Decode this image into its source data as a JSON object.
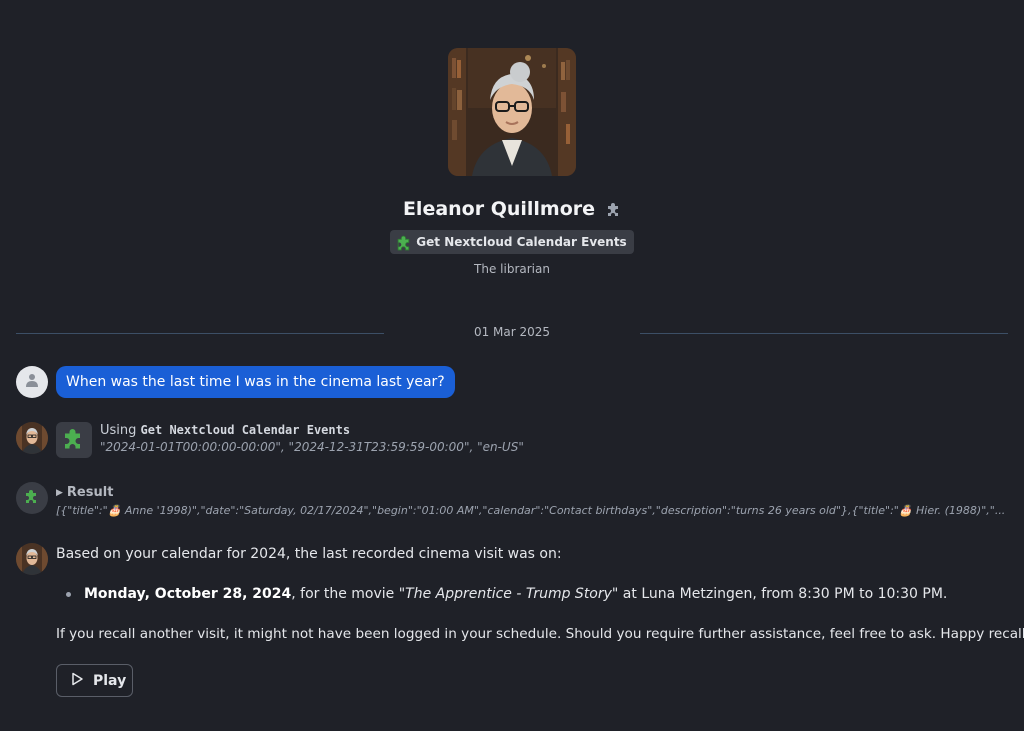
{
  "profile": {
    "name": "Eleanor Quillmore",
    "tool_badge": "Get Nextcloud Calendar Events",
    "subtitle": "The librarian",
    "avatar_icon": "librarian-portrait"
  },
  "divider": {
    "date": "01 Mar 2025"
  },
  "messages": {
    "user_question": "When was the last time I was in the cinema last year?",
    "tool_call": {
      "prefix": "Using",
      "tool_name": "Get Nextcloud Calendar Events",
      "args": "\"2024-01-01T00:00:00-00:00\", \"2024-12-31T23:59:59-00:00\", \"en-US\""
    },
    "result": {
      "label": "Result",
      "content": "[{\"title\":\"🎂 Anne          '1998)\",\"date\":\"Saturday, 02/17/2024\",\"begin\":\"01:00 AM\",\"calendar\":\"Contact birthdays\",\"description\":\"turns 26 years old\"},{\"title\":\"🎂 Hier.          (1988)\",\"..."
    },
    "answer": {
      "intro": "Based on your calendar for 2024, the last recorded cinema visit was on:",
      "bullet_date": "Monday, October 28, 2024",
      "bullet_mid": ", for the movie ",
      "bullet_movie": "\"The Apprentice - Trump Story\"",
      "bullet_tail": " at Luna Metzingen, from 8:30 PM to 10:30 PM.",
      "outro": "If you recall another visit, it might not have been logged in your schedule. Should you require further assistance, feel free to ask. Happy recalling!"
    },
    "play_label": "Play"
  },
  "colors": {
    "background": "#1f2128",
    "user_bubble": "#1a5fd6",
    "divider_line": "#3c4f66",
    "puzzle_green": "#4caf50"
  },
  "icons": [
    "puzzle-icon",
    "user-icon",
    "play-icon",
    "disclosure-triangle-icon"
  ]
}
